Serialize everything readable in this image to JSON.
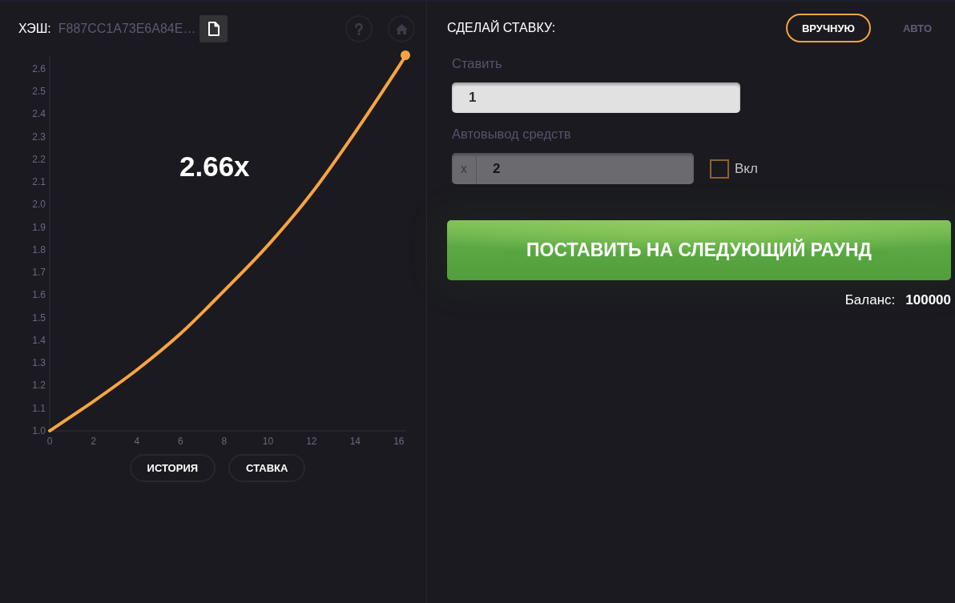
{
  "hash_bar": {
    "label": "ХЭШ:",
    "value": "F887CC1A73E6A84E…"
  },
  "game": {
    "multiplier": "2.66x",
    "chart_data": {
      "type": "line",
      "x": [
        0,
        2,
        4,
        6,
        8,
        10,
        12,
        14,
        16,
        16.3
      ],
      "series": [
        {
          "color": "#f7a440",
          "values": [
            1.0,
            1.13,
            1.27,
            1.43,
            1.62,
            1.82,
            2.05,
            2.32,
            2.61,
            2.66
          ]
        }
      ],
      "xlim": [
        0,
        16.3
      ],
      "ylim": [
        1.0,
        2.66
      ],
      "xticks": [
        0,
        2,
        4,
        6,
        8,
        10,
        12,
        14,
        16
      ],
      "yticks": [
        {
          "value": 1.0,
          "label": "1.0"
        },
        1.1,
        1.2,
        1.3,
        1.4,
        1.5,
        1.6,
        1.7,
        1.8,
        1.9,
        {
          "value": 2.0,
          "label": "2.0"
        },
        2.1,
        2.2,
        2.3,
        2.4,
        2.5,
        2.6
      ]
    },
    "buttons": [
      "ИСТОРИЯ",
      "СТАВКА"
    ]
  },
  "bet_panel": {
    "title": "СДЕЛАЙ СТАВКУ:",
    "modes": [
      {
        "label": "ВРУЧНУЮ",
        "selected": true
      },
      {
        "label": "АВТО",
        "selected": false
      }
    ],
    "bet": {
      "label": "Ставить",
      "value": "1"
    },
    "auto_cashout": {
      "label": "Автовывод средств",
      "prefix": "x",
      "value": "2",
      "toggle": {
        "label": "Вкл",
        "checked": false
      }
    },
    "submit_button": "ПОСТАВИТЬ НА СЛЕДУЮЩИЙ РАУНД",
    "balance": {
      "label": "Баланс:",
      "value": "100000"
    }
  }
}
